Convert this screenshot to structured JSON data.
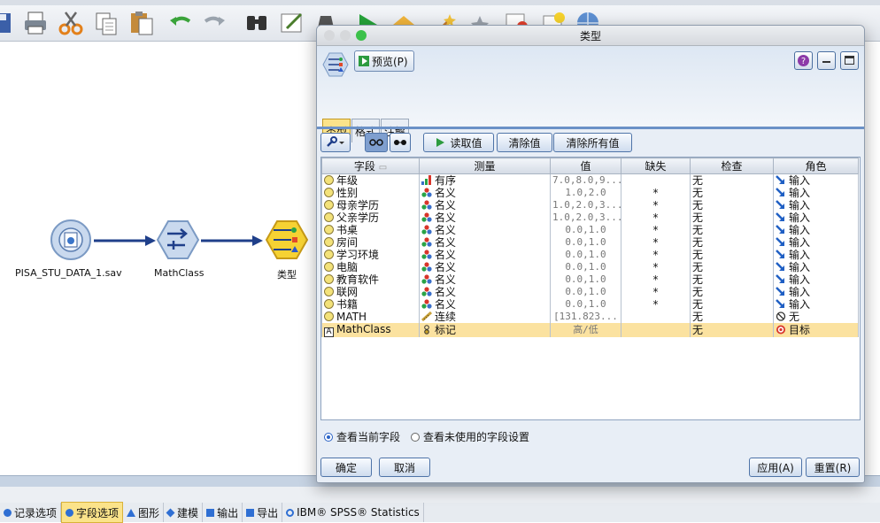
{
  "canvas": {
    "nodes": [
      {
        "label": "PISA_STU_DATA_1.sav"
      },
      {
        "label": "MathClass"
      },
      {
        "label": "类型"
      }
    ]
  },
  "palette_tabs": [
    {
      "label": "记录选项",
      "color": "#2f6fd3"
    },
    {
      "label": "字段选项",
      "color": "#2f6fd3",
      "active": true
    },
    {
      "label": "图形",
      "color": "#2f6fd3"
    },
    {
      "label": "建模",
      "color": "#2f6fd3"
    },
    {
      "label": "输出",
      "color": "#2f6fd3"
    },
    {
      "label": "导出",
      "color": "#2f6fd3"
    },
    {
      "label": "IBM® SPSS® Statistics",
      "color": "#2f6fd3"
    }
  ],
  "dialog": {
    "title": "类型",
    "preview_label": "预览(P)",
    "tabs": [
      "类型",
      "格式",
      "注解"
    ],
    "toolbar": {
      "read_values": "读取值",
      "clear_values": "清除值",
      "clear_all_values": "清除所有值"
    },
    "columns": [
      "字段",
      "测量",
      "值",
      "缺失",
      "检查",
      "角色"
    ],
    "rows": [
      {
        "field": "年级",
        "measure": "有序",
        "values": "7.0,8.0,9....",
        "missing": "",
        "check": "无",
        "role": "输入"
      },
      {
        "field": "性别",
        "measure": "名义",
        "values": "1.0,2.0",
        "missing": "*",
        "check": "无",
        "role": "输入"
      },
      {
        "field": "母亲学历",
        "measure": "名义",
        "values": "1.0,2.0,3....",
        "missing": "*",
        "check": "无",
        "role": "输入"
      },
      {
        "field": "父亲学历",
        "measure": "名义",
        "values": "1.0,2.0,3....",
        "missing": "*",
        "check": "无",
        "role": "输入"
      },
      {
        "field": "书桌",
        "measure": "名义",
        "values": "0.0,1.0",
        "missing": "*",
        "check": "无",
        "role": "输入"
      },
      {
        "field": "房间",
        "measure": "名义",
        "values": "0.0,1.0",
        "missing": "*",
        "check": "无",
        "role": "输入"
      },
      {
        "field": "学习环境",
        "measure": "名义",
        "values": "0.0,1.0",
        "missing": "*",
        "check": "无",
        "role": "输入"
      },
      {
        "field": "电脑",
        "measure": "名义",
        "values": "0.0,1.0",
        "missing": "*",
        "check": "无",
        "role": "输入"
      },
      {
        "field": "教育软件",
        "measure": "名义",
        "values": "0.0,1.0",
        "missing": "*",
        "check": "无",
        "role": "输入"
      },
      {
        "field": "联网",
        "measure": "名义",
        "values": "0.0,1.0",
        "missing": "*",
        "check": "无",
        "role": "输入"
      },
      {
        "field": "书籍",
        "measure": "名义",
        "values": "0.0,1.0",
        "missing": "*",
        "check": "无",
        "role": "输入"
      },
      {
        "field": "MATH",
        "measure": "连续",
        "values": "[131.823...",
        "missing": "",
        "check": "无",
        "role": "无"
      },
      {
        "field": "MathClass",
        "measure": "标记",
        "values": "高/低",
        "missing": "",
        "check": "无",
        "role": "目标"
      }
    ],
    "radio_current": "查看当前字段",
    "radio_unused": "查看未使用的字段设置",
    "ok": "确定",
    "cancel": "取消",
    "apply": "应用(A)",
    "reset": "重置(R)"
  }
}
